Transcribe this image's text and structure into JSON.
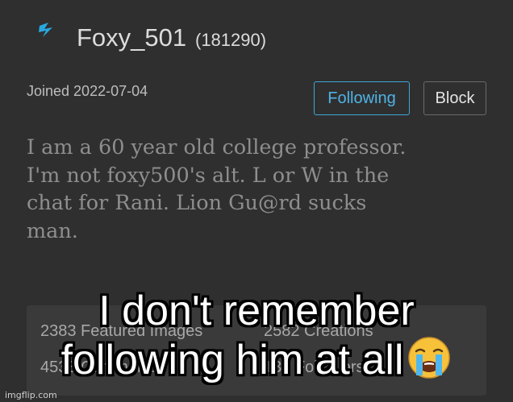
{
  "profile": {
    "username": "Foxy_501",
    "points": "(181290)",
    "joined": "Joined 2022-07-04",
    "bio_lines": [
      "I am a 60 year old college professor.",
      "I'm not foxy500's alt. L or W in the",
      "chat for Rani. Lion Gu@rd sucks",
      "man."
    ]
  },
  "actions": {
    "following_label": "Following",
    "block_label": "Block"
  },
  "stats": {
    "featured": "2383 Featured Images",
    "creations": "2582 Creations",
    "comments": "4533 Comments",
    "followers": "139 Followers"
  },
  "caption": {
    "line1": "I don't remember",
    "line2": "following him at all"
  },
  "watermark": "imgflip.com",
  "colors": {
    "background": "#2f2f2f",
    "accent": "#4fb3e6",
    "stats_box": "#3a3a3a"
  },
  "icons": {
    "avatar": "lightning-bolt-icon",
    "emoji": "loudly-crying-face-icon"
  }
}
